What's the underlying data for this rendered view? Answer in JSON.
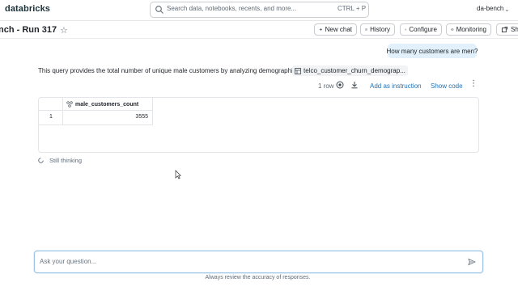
{
  "app": {
    "brand": "databricks",
    "workspace": "da-bench"
  },
  "search": {
    "placeholder": "Search data, notebooks, recents, and more...",
    "shortcut": "CTRL + P"
  },
  "header": {
    "title": "nch - Run 317",
    "buttons": {
      "new_chat": "New chat",
      "history": "History",
      "configure": "Configure",
      "monitoring": "Monitoring",
      "share": "Sha"
    }
  },
  "chat": {
    "user_message": "How many customers are men?",
    "answer": "This query provides the total number of unique male customers by analyzing demographic data.",
    "table_ref": "telco_customer_churn_demograp...",
    "row_count": "1 row",
    "add_instruction": "Add as instruction",
    "show_code": "Show code",
    "result": {
      "column": "male_customers_count",
      "rows": [
        {
          "index": "1",
          "value": "3555"
        }
      ]
    },
    "status": "Still thinking"
  },
  "input": {
    "placeholder": "Ask your question...",
    "value": ""
  },
  "footer": {
    "disclaimer": "Always review the accuracy of responses."
  },
  "colors": {
    "accent": "#2272b4",
    "bubble": "#e1f0fb",
    "brand": "#1b3139"
  },
  "icons": [
    "search-icon",
    "chevron-down-icon",
    "star-icon",
    "plus-icon",
    "history-icon",
    "gear-icon",
    "monitoring-icon",
    "share-icon",
    "table-icon",
    "code-run-icon",
    "download-icon",
    "kebab-icon",
    "column-type-icon",
    "spinner-icon",
    "cursor-icon",
    "send-icon"
  ]
}
